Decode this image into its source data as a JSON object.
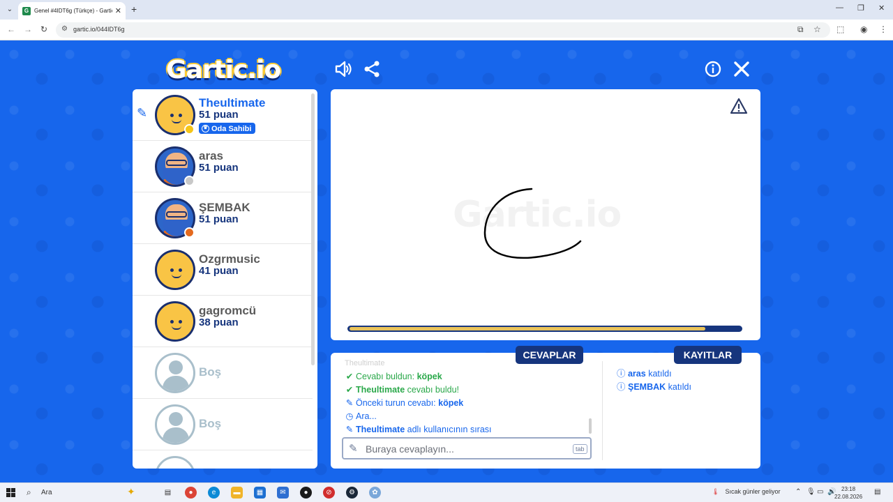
{
  "browser": {
    "tab_title": "Genel #4IDT6g (Türkçe) - Gartic",
    "tab_favicon": "G",
    "url": "gartic.io/044IDT6g"
  },
  "game": {
    "logo": "Gartic.io",
    "watermark": "Gartic.io",
    "timer_progress": 0.91,
    "players": [
      {
        "name": "Theultimate",
        "score": "51 puan",
        "badge": "Oda Sahibi",
        "drawing": true,
        "avatar": "yellow",
        "status_color": "#f5c518"
      },
      {
        "name": "aras",
        "score": "51 puan",
        "avatar": "bearded",
        "status_color": "#c8c8c8"
      },
      {
        "name": "ŞEMBAK",
        "score": "51 puan",
        "avatar": "bearded",
        "status_color": "#e46a1e"
      },
      {
        "name": "Ozgrmusic",
        "score": "41 puan",
        "avatar": "yellow"
      },
      {
        "name": "gagromcü",
        "score": "38 puan",
        "avatar": "yellow"
      },
      {
        "name": "Boş",
        "avatar": "empty"
      },
      {
        "name": "Boş",
        "avatar": "empty"
      }
    ],
    "answers_label": "CEVAPLAR",
    "logs_label": "KAYITLAR",
    "answers": {
      "faded": "Theultimate",
      "line1_prefix": "Cevabı buldun: ",
      "line1_word": "köpek",
      "line2_name": "Theultimate",
      "line2_text": " cevabı buldu!",
      "line3_prefix": "Önceki turun cevabı: ",
      "line3_word": "köpek",
      "line4": "Ara...",
      "line5_name": "Theultimate",
      "line5_text": " adlı kullanıcının sırası"
    },
    "input_placeholder": "Buraya cevaplayın...",
    "input_key": "tab",
    "logs": [
      {
        "name": "aras",
        "text": " katıldı"
      },
      {
        "name": "ŞEMBAK",
        "text": " katıldı"
      }
    ]
  },
  "taskbar": {
    "search": "Ara",
    "weather": "Sıcak günler geliyor",
    "time": "23:18",
    "date": "22.08.2026"
  },
  "colors": {
    "brand_blue": "#1766ec",
    "navy": "#16357d",
    "timer": "#e9c35a",
    "green": "#2aa84a"
  }
}
